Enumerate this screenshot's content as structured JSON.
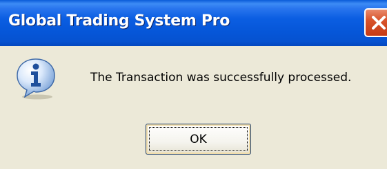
{
  "window": {
    "title": "Global Trading System Pro",
    "close_icon": "close-icon"
  },
  "dialog": {
    "icon": "info-icon",
    "message": "The Transaction was successfully processed.",
    "ok_label": "OK"
  },
  "colors": {
    "titlebar": "#0b5ee2",
    "body": "#ece9d8",
    "close_button": "#d8542c"
  }
}
